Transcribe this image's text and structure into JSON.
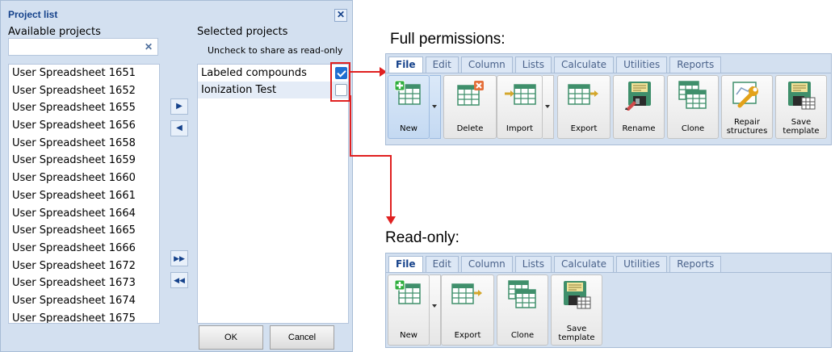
{
  "dialog": {
    "title": "Project list",
    "available_label": "Available projects",
    "selected_label": "Selected projects",
    "hint": "Uncheck to share as read-only",
    "search_value": "",
    "available": [
      "User Spreadsheet 1651",
      "User Spreadsheet 1652",
      "User Spreadsheet 1655",
      "User Spreadsheet 1656",
      "User Spreadsheet 1658",
      "User Spreadsheet 1659",
      "User Spreadsheet 1660",
      "User Spreadsheet 1661",
      "User Spreadsheet 1664",
      "User Spreadsheet 1665",
      "User Spreadsheet 1666",
      "User Spreadsheet 1672",
      "User Spreadsheet 1673",
      "User Spreadsheet 1674",
      "User Spreadsheet 1675"
    ],
    "selected": [
      {
        "name": "Labeled compounds",
        "checked": true
      },
      {
        "name": "Ionization Test",
        "checked": false
      }
    ],
    "ok_label": "OK",
    "cancel_label": "Cancel",
    "move_buttons": [
      "move-right-icon",
      "move-left-icon",
      "move-all-right-icon",
      "move-all-left-icon"
    ]
  },
  "full_heading": "Full permissions:",
  "readonly_heading": "Read-only:",
  "tabs": [
    "File",
    "Edit",
    "Column",
    "Lists",
    "Calculate",
    "Utilities",
    "Reports"
  ],
  "full_tools": [
    "New",
    "Delete",
    "Import",
    "Export",
    "Rename",
    "Clone",
    "Repair structures",
    "Save template"
  ],
  "readonly_tools": [
    "New",
    "Export",
    "Clone",
    "Save template"
  ],
  "colors": {
    "accent_red": "#e02020",
    "panel": "#d3e0f0",
    "grid_green": "#3f8f6b",
    "check_blue": "#1f6fd1"
  }
}
